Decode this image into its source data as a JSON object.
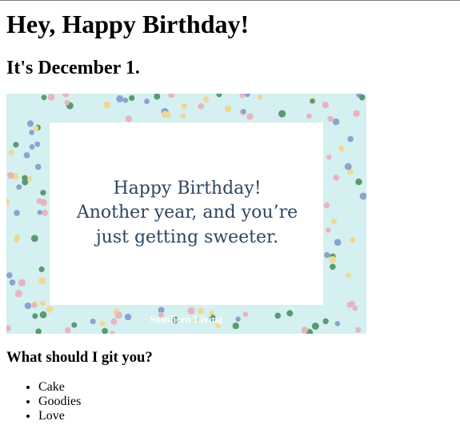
{
  "heading": "Hey, Happy Birthday!",
  "date_line": "It's December 1.",
  "card": {
    "message_lines": [
      "Happy Birthday!",
      "Another year, and you’re",
      "just getting sweeter."
    ],
    "brand": "Southern Living",
    "background_color": "#d4f0f0",
    "panel_color": "#ffffff",
    "text_color": "#2d4660",
    "dot_colors": [
      "#e8b4c0",
      "#f0d890",
      "#8aa4d0",
      "#5a9a70"
    ]
  },
  "question": "What should I git you?",
  "gifts": [
    "Cake",
    "Goodies",
    "Love"
  ]
}
